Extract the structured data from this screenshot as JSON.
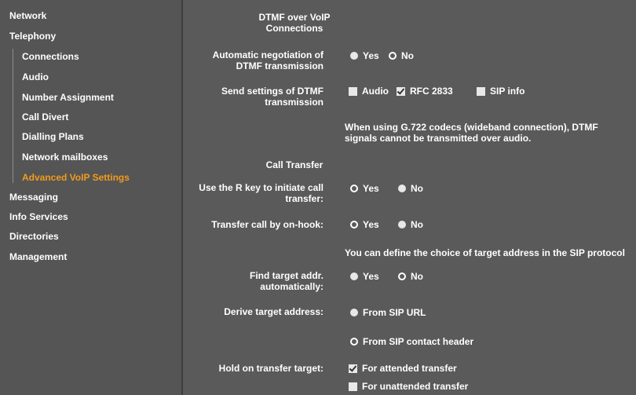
{
  "sidebar": {
    "network": "Network",
    "telephony": "Telephony",
    "sub": [
      "Connections",
      "Audio",
      "Number Assignment",
      "Call Divert",
      "Dialling Plans",
      "Network mailboxes",
      "Advanced VoIP Settings"
    ],
    "messaging": "Messaging",
    "info_services": "Info Services",
    "directories": "Directories",
    "management": "Management"
  },
  "dtmf": {
    "title1": "DTMF over VoIP",
    "title2": "Connections",
    "auto_label1": "Automatic negotiation of",
    "auto_label2": "DTMF transmission",
    "yes": "Yes",
    "no": "No",
    "send_label1": "Send settings of DTMF",
    "send_label2": "transmission",
    "audio": "Audio",
    "rfc": "RFC 2833",
    "sipinfo": "SIP info",
    "note1": "When using G.722 codecs (wideband connection), DTMF",
    "note2": "signals cannot be transmitted over audio."
  },
  "transfer": {
    "title": "Call Transfer",
    "rkey_label1": "Use the R key to initiate call",
    "rkey_label2": "transfer:",
    "onhook_label": "Transfer call by on-hook:",
    "note": "You can define the choice of target address in the SIP protocol",
    "find_label1": "Find target addr.",
    "find_label2": "automatically:",
    "derive_label": "Derive target address:",
    "from_sip_url": "From SIP URL",
    "from_contact": "From SIP contact header",
    "hold_label": "Hold on transfer target:",
    "attended": "For attended transfer",
    "unattended": "For unattended transfer",
    "yes": "Yes",
    "no": "No"
  }
}
